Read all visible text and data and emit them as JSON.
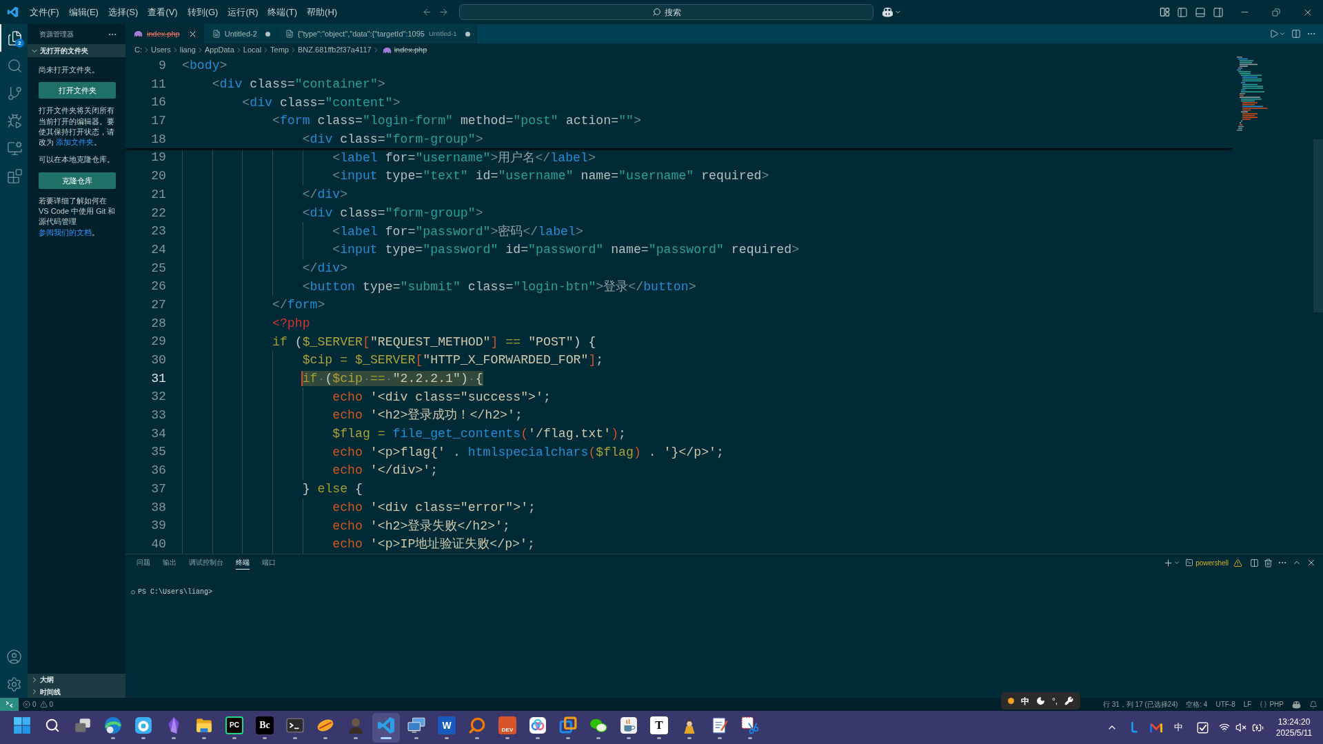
{
  "title_bar": {
    "menu": [
      "文件(F)",
      "编辑(E)",
      "选择(S)",
      "查看(V)",
      "转到(G)",
      "运行(R)",
      "终端(T)",
      "帮助(H)"
    ],
    "search": {
      "placeholder": "搜索"
    }
  },
  "activity_bar": {
    "items": [
      {
        "kind": "explorer",
        "selected": true,
        "badge": "2"
      },
      {
        "kind": "search",
        "selected": false
      },
      {
        "kind": "source_control",
        "selected": false
      },
      {
        "kind": "run",
        "selected": false
      },
      {
        "kind": "remote",
        "selected": false
      },
      {
        "kind": "extensions",
        "selected": false
      }
    ]
  },
  "sidebar": {
    "title": "资源管理器",
    "section": {
      "title": "无打开的文件夹",
      "expanded": true
    },
    "content": [
      {
        "kind": "text",
        "text": "尚未打开文件夹。"
      },
      {
        "kind": "button",
        "text": "打开文件夹"
      },
      {
        "kind": "text",
        "text": "打开文件夹将关闭所有当前打开的编辑器。要使其保持打开状态，请改为 ",
        "link": "添加文件夹",
        "after": "。"
      },
      {
        "kind": "text",
        "text": "可以在本地克隆仓库。"
      },
      {
        "kind": "button",
        "text": "克隆仓库"
      },
      {
        "kind": "text",
        "text": "若要详细了解如何在 VS Code 中使用 Git 和源代码管理",
        "link": "参阅我们的文档",
        "after": "。"
      }
    ],
    "bottom_sections": [
      {
        "title": "大纲",
        "expanded": false
      },
      {
        "title": "时间线",
        "expanded": false
      }
    ]
  },
  "tabs": [
    {
      "kind": "php",
      "title": "index.php",
      "selected": true,
      "modified": false,
      "deleted": true
    },
    {
      "kind": "file",
      "title": "Untitled-2",
      "selected": false,
      "modified": true,
      "deleted": false
    },
    {
      "kind": "file",
      "title": "{\"type\":\"object\",\"data\":{\"targetId\":1095",
      "description": "Untitled-1",
      "selected": false,
      "modified": true,
      "deleted": false
    }
  ],
  "breadcrumb": {
    "folders": [
      "C:",
      "Users",
      "liang",
      "AppData",
      "Local",
      "Temp",
      "BNZ.681ffb2f37a4117"
    ],
    "file": {
      "kind": "php",
      "name": "index.php",
      "deleted": true
    }
  },
  "editor": {
    "sticky_lines": [
      {
        "number": "9",
        "tokens": [
          {
            "kind": "punct",
            "text": "<"
          },
          {
            "kind": "tag",
            "text": "body"
          },
          {
            "kind": "punct",
            "text": ">"
          }
        ]
      },
      {
        "number": "11",
        "tokens": [
          {
            "kind": "punct",
            "text": "    <"
          },
          {
            "kind": "tag",
            "text": "div"
          },
          {
            "kind": "attr",
            "text": " class"
          },
          {
            "kind": "eq",
            "text": "="
          },
          {
            "kind": "string",
            "text": "\"container\""
          },
          {
            "kind": "punct",
            "text": ">"
          }
        ]
      },
      {
        "number": "16",
        "tokens": [
          {
            "kind": "punct",
            "text": "        <"
          },
          {
            "kind": "tag",
            "text": "div"
          },
          {
            "kind": "attr",
            "text": " class"
          },
          {
            "kind": "eq",
            "text": "="
          },
          {
            "kind": "string",
            "text": "\"content\""
          },
          {
            "kind": "punct",
            "text": ">"
          }
        ]
      },
      {
        "number": "17",
        "tokens": [
          {
            "kind": "punct",
            "text": "            <"
          },
          {
            "kind": "tag",
            "text": "form"
          },
          {
            "kind": "attr",
            "text": " class"
          },
          {
            "kind": "eq",
            "text": "="
          },
          {
            "kind": "string",
            "text": "\"login-form\""
          },
          {
            "kind": "attr",
            "text": " method"
          },
          {
            "kind": "eq",
            "text": "="
          },
          {
            "kind": "string",
            "text": "\"post\""
          },
          {
            "kind": "attr",
            "text": " action"
          },
          {
            "kind": "eq",
            "text": "="
          },
          {
            "kind": "string",
            "text": "\"\""
          },
          {
            "kind": "punct",
            "text": ">"
          }
        ]
      },
      {
        "number": "18",
        "tokens": [
          {
            "kind": "punct",
            "text": "                <"
          },
          {
            "kind": "tag",
            "text": "div"
          },
          {
            "kind": "attr",
            "text": " class"
          },
          {
            "kind": "eq",
            "text": "="
          },
          {
            "kind": "string",
            "text": "\"form-group\""
          },
          {
            "kind": "punct",
            "text": ">"
          }
        ]
      }
    ],
    "lines": [
      {
        "number": "19",
        "current": false,
        "selected": false,
        "tokens": [
          {
            "kind": "punct",
            "text": "                    <"
          },
          {
            "kind": "tag",
            "text": "label"
          },
          {
            "kind": "attr",
            "text": " for"
          },
          {
            "kind": "eq",
            "text": "="
          },
          {
            "kind": "string",
            "text": "\"username\""
          },
          {
            "kind": "punct",
            "text": ">"
          },
          {
            "kind": "text",
            "text": "用户名"
          },
          {
            "kind": "punct",
            "text": "</"
          },
          {
            "kind": "tag",
            "text": "label"
          },
          {
            "kind": "punct",
            "text": ">"
          }
        ]
      },
      {
        "number": "20",
        "current": false,
        "selected": false,
        "tokens": [
          {
            "kind": "punct",
            "text": "                    <"
          },
          {
            "kind": "tag",
            "text": "input"
          },
          {
            "kind": "attr",
            "text": " type"
          },
          {
            "kind": "eq",
            "text": "="
          },
          {
            "kind": "string",
            "text": "\"text\""
          },
          {
            "kind": "attr",
            "text": " id"
          },
          {
            "kind": "eq",
            "text": "="
          },
          {
            "kind": "string",
            "text": "\"username\""
          },
          {
            "kind": "attr",
            "text": " name"
          },
          {
            "kind": "eq",
            "text": "="
          },
          {
            "kind": "string",
            "text": "\"username\""
          },
          {
            "kind": "attr",
            "text": " required"
          },
          {
            "kind": "punct",
            "text": ">"
          }
        ]
      },
      {
        "number": "21",
        "current": false,
        "selected": false,
        "tokens": [
          {
            "kind": "punct",
            "text": "                </"
          },
          {
            "kind": "tag",
            "text": "div"
          },
          {
            "kind": "punct",
            "text": ">"
          }
        ]
      },
      {
        "number": "22",
        "current": false,
        "selected": false,
        "tokens": [
          {
            "kind": "punct",
            "text": "                <"
          },
          {
            "kind": "tag",
            "text": "div"
          },
          {
            "kind": "attr",
            "text": " class"
          },
          {
            "kind": "eq",
            "text": "="
          },
          {
            "kind": "string",
            "text": "\"form-group\""
          },
          {
            "kind": "punct",
            "text": ">"
          }
        ]
      },
      {
        "number": "23",
        "current": false,
        "selected": false,
        "tokens": [
          {
            "kind": "punct",
            "text": "                    <"
          },
          {
            "kind": "tag",
            "text": "label"
          },
          {
            "kind": "attr",
            "text": " for"
          },
          {
            "kind": "eq",
            "text": "="
          },
          {
            "kind": "string",
            "text": "\"password\""
          },
          {
            "kind": "punct",
            "text": ">"
          },
          {
            "kind": "text",
            "text": "密码"
          },
          {
            "kind": "punct",
            "text": "</"
          },
          {
            "kind": "tag",
            "text": "label"
          },
          {
            "kind": "punct",
            "text": ">"
          }
        ]
      },
      {
        "number": "24",
        "current": false,
        "selected": false,
        "tokens": [
          {
            "kind": "punct",
            "text": "                    <"
          },
          {
            "kind": "tag",
            "text": "input"
          },
          {
            "kind": "attr",
            "text": " type"
          },
          {
            "kind": "eq",
            "text": "="
          },
          {
            "kind": "string",
            "text": "\"password\""
          },
          {
            "kind": "attr",
            "text": " id"
          },
          {
            "kind": "eq",
            "text": "="
          },
          {
            "kind": "string",
            "text": "\"password\""
          },
          {
            "kind": "attr",
            "text": " name"
          },
          {
            "kind": "eq",
            "text": "="
          },
          {
            "kind": "string",
            "text": "\"password\""
          },
          {
            "kind": "attr",
            "text": " required"
          },
          {
            "kind": "punct",
            "text": ">"
          }
        ]
      },
      {
        "number": "25",
        "current": false,
        "selected": false,
        "tokens": [
          {
            "kind": "punct",
            "text": "                </"
          },
          {
            "kind": "tag",
            "text": "div"
          },
          {
            "kind": "punct",
            "text": ">"
          }
        ]
      },
      {
        "number": "26",
        "current": false,
        "selected": false,
        "tokens": [
          {
            "kind": "punct",
            "text": "                <"
          },
          {
            "kind": "tag",
            "text": "button"
          },
          {
            "kind": "attr",
            "text": " type"
          },
          {
            "kind": "eq",
            "text": "="
          },
          {
            "kind": "string",
            "text": "\"submit\""
          },
          {
            "kind": "attr",
            "text": " class"
          },
          {
            "kind": "eq",
            "text": "="
          },
          {
            "kind": "string",
            "text": "\"login-btn\""
          },
          {
            "kind": "punct",
            "text": ">"
          },
          {
            "kind": "text",
            "text": "登录"
          },
          {
            "kind": "punct",
            "text": "</"
          },
          {
            "kind": "tag",
            "text": "button"
          },
          {
            "kind": "punct",
            "text": ">"
          }
        ]
      },
      {
        "number": "27",
        "current": false,
        "selected": false,
        "tokens": [
          {
            "kind": "punct",
            "text": "            </"
          },
          {
            "kind": "tag",
            "text": "form"
          },
          {
            "kind": "punct",
            "text": ">"
          }
        ]
      },
      {
        "number": "28",
        "current": false,
        "selected": false,
        "tokens": [
          {
            "kind": "php_tag",
            "text": "            <?php"
          }
        ]
      },
      {
        "number": "29",
        "current": false,
        "selected": false,
        "tokens": [
          {
            "kind": "keyword",
            "text": "            if"
          },
          {
            "kind": "bracket1",
            "text": " ("
          },
          {
            "kind": "variable",
            "text": "$_SERVER"
          },
          {
            "kind": "bracket2",
            "text": "["
          },
          {
            "kind": "php_string",
            "text": "\"REQUEST_METHOD\""
          },
          {
            "kind": "bracket2",
            "text": "]"
          },
          {
            "kind": "operator",
            "text": " == "
          },
          {
            "kind": "php_string",
            "text": "\"POST\""
          },
          {
            "kind": "bracket1",
            "text": ")"
          },
          {
            "kind": "bracket1",
            "text": " {"
          }
        ]
      },
      {
        "number": "30",
        "current": false,
        "selected": false,
        "tokens": [
          {
            "kind": "variable",
            "text": "                $cip"
          },
          {
            "kind": "operator",
            "text": " = "
          },
          {
            "kind": "variable",
            "text": "$_SERVER"
          },
          {
            "kind": "bracket2",
            "text": "["
          },
          {
            "kind": "php_string",
            "text": "\"HTTP_X_FORWARDED_FOR\""
          },
          {
            "kind": "bracket2",
            "text": "]"
          },
          {
            "kind": "op",
            "text": ";"
          }
        ]
      },
      {
        "number": "31",
        "current": true,
        "selected": true,
        "tokens": [
          {
            "kind": "keyword",
            "text": "                if"
          },
          {
            "kind": "bracket1",
            "text": " ("
          },
          {
            "kind": "variable",
            "text": "$cip"
          },
          {
            "kind": "operator",
            "text": " == "
          },
          {
            "kind": "php_string",
            "text": "\"2.2.2.1\""
          },
          {
            "kind": "bracket1",
            "text": ")"
          },
          {
            "kind": "bracket1",
            "text": " {"
          }
        ]
      },
      {
        "number": "32",
        "current": false,
        "selected": false,
        "tokens": [
          {
            "kind": "echo",
            "text": "                    echo"
          },
          {
            "kind": "php_string",
            "text": " '<div class=\"success\">'"
          },
          {
            "kind": "op",
            "text": ";"
          }
        ]
      },
      {
        "number": "33",
        "current": false,
        "selected": false,
        "tokens": [
          {
            "kind": "echo",
            "text": "                    echo"
          },
          {
            "kind": "php_string",
            "text": " '<h2>登录成功！</h2>'"
          },
          {
            "kind": "op",
            "text": ";"
          }
        ]
      },
      {
        "number": "34",
        "current": false,
        "selected": false,
        "tokens": [
          {
            "kind": "variable",
            "text": "                    $flag"
          },
          {
            "kind": "operator",
            "text": " = "
          },
          {
            "kind": "function",
            "text": "file_get_contents"
          },
          {
            "kind": "bracket2",
            "text": "("
          },
          {
            "kind": "php_string",
            "text": "'/flag.txt'"
          },
          {
            "kind": "bracket2",
            "text": ")"
          },
          {
            "kind": "op",
            "text": ";"
          }
        ]
      },
      {
        "number": "35",
        "current": false,
        "selected": false,
        "tokens": [
          {
            "kind": "echo",
            "text": "                    echo"
          },
          {
            "kind": "php_string",
            "text": " '<p>flag{'"
          },
          {
            "kind": "op",
            "text": " . "
          },
          {
            "kind": "function",
            "text": "htmlspecialchars"
          },
          {
            "kind": "bracket2",
            "text": "("
          },
          {
            "kind": "variable",
            "text": "$flag"
          },
          {
            "kind": "bracket2",
            "text": ")"
          },
          {
            "kind": "op",
            "text": " . "
          },
          {
            "kind": "php_string",
            "text": "'}</p>'"
          },
          {
            "kind": "op",
            "text": ";"
          }
        ]
      },
      {
        "number": "36",
        "current": false,
        "selected": false,
        "tokens": [
          {
            "kind": "echo",
            "text": "                    echo"
          },
          {
            "kind": "php_string",
            "text": " '</div>'"
          },
          {
            "kind": "op",
            "text": ";"
          }
        ]
      },
      {
        "number": "37",
        "current": false,
        "selected": false,
        "tokens": [
          {
            "kind": "bracket1",
            "text": "                }"
          },
          {
            "kind": "keyword",
            "text": " else "
          },
          {
            "kind": "bracket1",
            "text": "{"
          }
        ]
      },
      {
        "number": "38",
        "current": false,
        "selected": false,
        "tokens": [
          {
            "kind": "echo",
            "text": "                    echo"
          },
          {
            "kind": "php_string",
            "text": " '<div class=\"error\">'"
          },
          {
            "kind": "op",
            "text": ";"
          }
        ]
      },
      {
        "number": "39",
        "current": false,
        "selected": false,
        "tokens": [
          {
            "kind": "echo",
            "text": "                    echo"
          },
          {
            "kind": "php_string",
            "text": " '<h2>登录失败</h2>'"
          },
          {
            "kind": "op",
            "text": ";"
          }
        ]
      },
      {
        "number": "40",
        "current": false,
        "selected": false,
        "tokens": [
          {
            "kind": "echo",
            "text": "                    echo"
          },
          {
            "kind": "php_string",
            "text": " '<p>IP地址验证失败</p>'"
          },
          {
            "kind": "op",
            "text": ";"
          }
        ]
      }
    ]
  },
  "panel": {
    "tabs": [
      {
        "label": "问题",
        "selected": false
      },
      {
        "label": "输出",
        "selected": false
      },
      {
        "label": "调试控制台",
        "selected": false
      },
      {
        "label": "终端",
        "selected": true
      },
      {
        "label": "端口",
        "selected": false
      }
    ],
    "shell": {
      "name": "powershell",
      "warning": true
    },
    "terminal_lines": [
      "PS C:\\Users\\liang>"
    ]
  },
  "status_bar": {
    "errors": "0",
    "warnings": "0",
    "cursor": "行 31，列 17 (已选择24)",
    "indent": "空格: 4",
    "encoding": "UTF-8",
    "eol": "LF",
    "language": "PHP"
  },
  "ime_toolbar": {
    "mode": "中",
    "punctuation": "°,"
  },
  "taskbar": {
    "apps": [
      {
        "kind": "start",
        "running": false,
        "selected": false
      },
      {
        "kind": "search",
        "running": false,
        "selected": false
      },
      {
        "kind": "task_view",
        "running": false,
        "selected": false
      },
      {
        "kind": "browser",
        "running": true,
        "selected": false
      },
      {
        "kind": "blue_tile",
        "running": true,
        "selected": false
      },
      {
        "kind": "gem",
        "running": true,
        "selected": false
      },
      {
        "kind": "folder",
        "running": true,
        "selected": false
      },
      {
        "kind": "dark_tile",
        "label": "PC",
        "running": true,
        "selected": false
      },
      {
        "kind": "black_tile",
        "label": "Bc",
        "running": true,
        "selected": false
      },
      {
        "kind": "terminal",
        "running": true,
        "selected": false
      },
      {
        "kind": "leaf",
        "running": true,
        "selected": false
      },
      {
        "kind": "person",
        "running": true,
        "selected": false
      },
      {
        "kind": "ribbon",
        "running": true,
        "selected": true
      },
      {
        "kind": "monitors",
        "running": true,
        "selected": false
      },
      {
        "kind": "blue_doc",
        "label": "W",
        "running": true,
        "selected": false
      },
      {
        "kind": "magnifier",
        "running": true,
        "selected": false
      },
      {
        "kind": "red_tile",
        "label": "DEV",
        "running": true,
        "selected": false
      },
      {
        "kind": "rings",
        "running": true,
        "selected": false
      },
      {
        "kind": "squares",
        "running": true,
        "selected": false
      },
      {
        "kind": "chat",
        "running": true,
        "selected": false
      },
      {
        "kind": "cup",
        "running": true,
        "selected": false
      },
      {
        "kind": "white_tile",
        "label": "T",
        "running": true,
        "selected": false
      },
      {
        "kind": "figure",
        "running": true,
        "selected": false
      },
      {
        "kind": "notepad",
        "running": true,
        "selected": false
      },
      {
        "kind": "scissors",
        "running": true,
        "selected": false
      }
    ],
    "tray": {
      "input_mode": "中",
      "muted": true,
      "time": "13:24:20",
      "date": "2025/5/11"
    }
  }
}
